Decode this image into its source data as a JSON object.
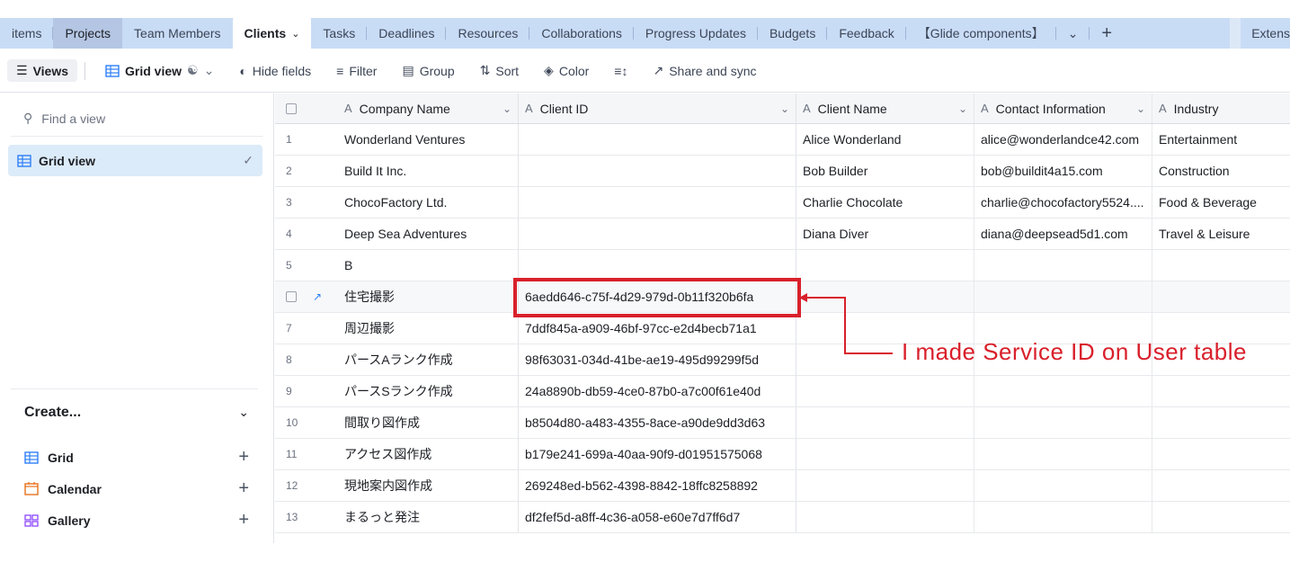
{
  "tabs": [
    {
      "label": "items",
      "name": "tab-items"
    },
    {
      "label": "Projects",
      "name": "tab-projects"
    },
    {
      "label": "Team Members",
      "name": "tab-team-members"
    },
    {
      "label": "Clients",
      "name": "tab-clients"
    },
    {
      "label": "Tasks",
      "name": "tab-tasks"
    },
    {
      "label": "Deadlines",
      "name": "tab-deadlines"
    },
    {
      "label": "Resources",
      "name": "tab-resources"
    },
    {
      "label": "Collaborations",
      "name": "tab-collaborations"
    },
    {
      "label": "Progress Updates",
      "name": "tab-progress-updates"
    },
    {
      "label": "Budgets",
      "name": "tab-budgets"
    },
    {
      "label": "Feedback",
      "name": "tab-feedback"
    },
    {
      "label": "【Glide components】",
      "name": "tab-glide-components"
    }
  ],
  "tab_extensions": "Extens",
  "toolbar": {
    "views": "Views",
    "grid_view": "Grid view",
    "hide_fields": "Hide fields",
    "filter": "Filter",
    "group": "Group",
    "sort": "Sort",
    "color": "Color",
    "share": "Share and sync"
  },
  "sidebar": {
    "find_placeholder": "Find a view",
    "view_item": "Grid view",
    "create_label": "Create...",
    "create_items": [
      "Grid",
      "Calendar",
      "Gallery"
    ]
  },
  "columns": [
    "Company Name",
    "Client ID",
    "Client Name",
    "Contact Information",
    "Industry"
  ],
  "rows": [
    {
      "num": "1",
      "company": "Wonderland Ventures",
      "client_id": "",
      "client_name": "Alice Wonderland",
      "contact": "alice@wonderlandce42.com",
      "industry": "Entertainment"
    },
    {
      "num": "2",
      "company": "Build It Inc.",
      "client_id": "",
      "client_name": "Bob Builder",
      "contact": "bob@buildit4a15.com",
      "industry": "Construction"
    },
    {
      "num": "3",
      "company": "ChocoFactory Ltd.",
      "client_id": "",
      "client_name": "Charlie Chocolate",
      "contact": "charlie@chocofactory5524....",
      "industry": "Food & Beverage"
    },
    {
      "num": "4",
      "company": "Deep Sea Adventures",
      "client_id": "",
      "client_name": "Diana Diver",
      "contact": "diana@deepsead5d1.com",
      "industry": "Travel & Leisure"
    },
    {
      "num": "5",
      "company": "B",
      "client_id": "",
      "client_name": "",
      "contact": "",
      "industry": ""
    },
    {
      "num": "",
      "company": "住宅撮影",
      "client_id": "6aedd646-c75f-4d29-979d-0b11f320b6fa",
      "client_name": "",
      "contact": "",
      "industry": ""
    },
    {
      "num": "7",
      "company": "周辺撮影",
      "client_id": "7ddf845a-a909-46bf-97cc-e2d4becb71a1",
      "client_name": "",
      "contact": "",
      "industry": ""
    },
    {
      "num": "8",
      "company": "パースAランク作成",
      "client_id": "98f63031-034d-41be-ae19-495d99299f5d",
      "client_name": "",
      "contact": "",
      "industry": ""
    },
    {
      "num": "9",
      "company": "パースSランク作成",
      "client_id": "24a8890b-db59-4ce0-87b0-a7c00f61e40d",
      "client_name": "",
      "contact": "",
      "industry": ""
    },
    {
      "num": "10",
      "company": "間取り図作成",
      "client_id": "b8504d80-a483-4355-8ace-a90de9dd3d63",
      "client_name": "",
      "contact": "",
      "industry": ""
    },
    {
      "num": "11",
      "company": "アクセス図作成",
      "client_id": "b179e241-699a-40aa-90f9-d01951575068",
      "client_name": "",
      "contact": "",
      "industry": ""
    },
    {
      "num": "12",
      "company": "現地案内図作成",
      "client_id": "269248ed-b562-4398-8842-18ffc8258892",
      "client_name": "",
      "contact": "",
      "industry": ""
    },
    {
      "num": "13",
      "company": "まるっと発注",
      "client_id": "df2fef5d-a8ff-4c36-a058-e60e7d7ff6d7",
      "client_name": "",
      "contact": "",
      "industry": ""
    }
  ],
  "annotation": "I made Service ID on User table",
  "colors": {
    "accent": "#2d7ff9",
    "annotation": "#d9202b",
    "tabbar": "#c9dcf6"
  }
}
